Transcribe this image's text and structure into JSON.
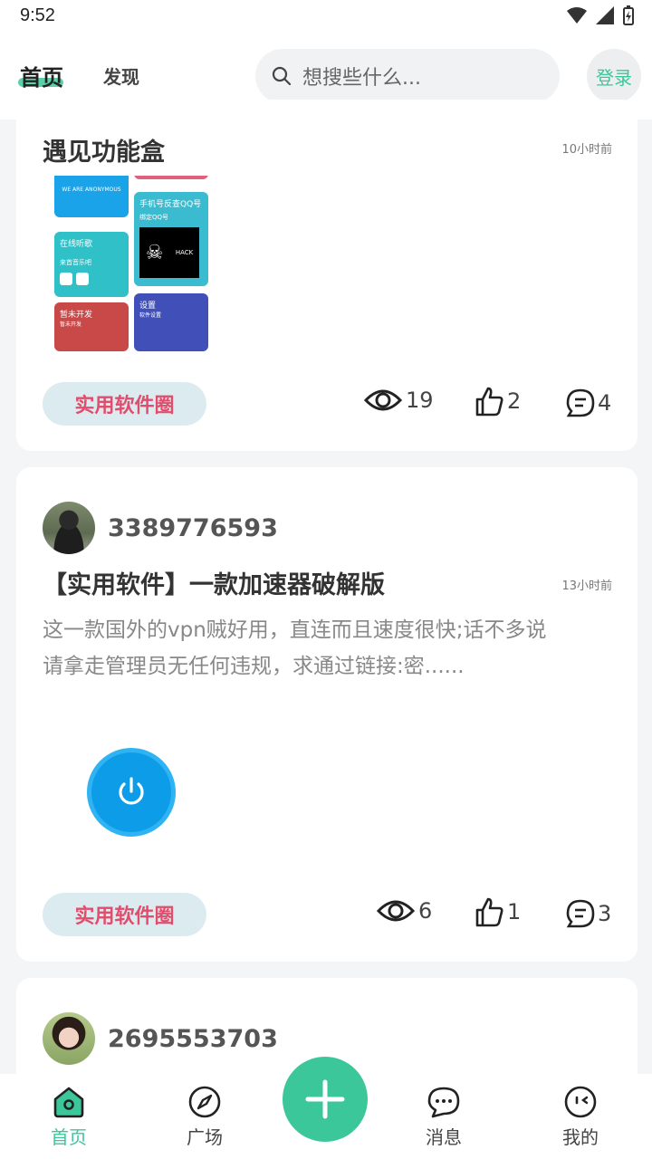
{
  "status": {
    "time": "9:52"
  },
  "header": {
    "tabs": [
      {
        "label": "首页"
      },
      {
        "label": "发现"
      }
    ],
    "search_placeholder": "想搜些什么...",
    "login_label": "登录"
  },
  "posts": [
    {
      "title": "遇见功能盒",
      "time": "10小时前",
      "tag": "实用软件圈",
      "views": "19",
      "likes": "2",
      "comments": "4",
      "thumbnail_tiles": [
        {
          "title": "WE ARE ANONYMOUS",
          "subtitle": ""
        },
        {
          "title": "手机号反查QQ号",
          "subtitle": "绑定QQ号"
        },
        {
          "title": "在线听歌",
          "subtitle": "来首音乐吧"
        },
        {
          "title": "HACK",
          "subtitle": ""
        },
        {
          "title": "暂未开发",
          "subtitle": "暂未开发"
        },
        {
          "title": "设置",
          "subtitle": "软件设置"
        }
      ]
    },
    {
      "author": "3389776593",
      "title": "【实用软件】一款加速器破解版",
      "time": "13小时前",
      "excerpt_line1": "这一款国外的vpn贼好用，直连而且速度很快;话不多说",
      "excerpt_line2": "请拿走管理员无任何违规，求通过链接:密......",
      "tag": "实用软件圈",
      "views": "6",
      "likes": "1",
      "comments": "3"
    },
    {
      "author": "2695553703"
    }
  ],
  "nav": {
    "items": [
      {
        "label": "首页"
      },
      {
        "label": "广场"
      },
      {
        "label": "消息"
      },
      {
        "label": "我的"
      }
    ]
  },
  "colors": {
    "accent": "#3cc79b",
    "tag_text": "#e04d6d",
    "tag_bg": "#dcebef"
  }
}
